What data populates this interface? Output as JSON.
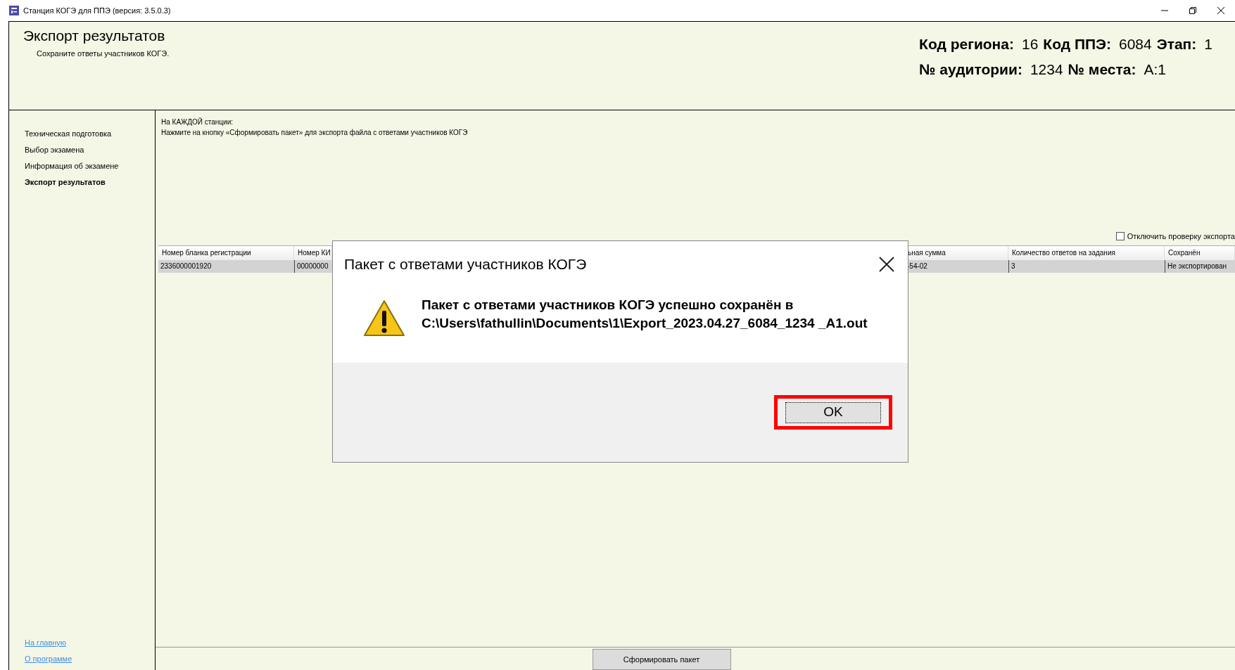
{
  "window": {
    "title": "Станция КОГЭ для ППЭ (версия: 3.5.0.3)"
  },
  "header": {
    "title": "Экспорт результатов",
    "subtitle": "Сохраните ответы участников КОГЭ.",
    "info_lines": [
      [
        {
          "label": "Код региона:",
          "value": "16"
        },
        {
          "label": "Код ППЭ:",
          "value": "6084"
        },
        {
          "label": "Этап:",
          "value": "1"
        }
      ],
      [
        {
          "label": "№ аудитории:",
          "value": "1234"
        },
        {
          "label": "№ места:",
          "value": "А:1"
        }
      ]
    ]
  },
  "sidebar": {
    "items": [
      {
        "label": "Техническая подготовка",
        "selected": false
      },
      {
        "label": "Выбор экзамена",
        "selected": false
      },
      {
        "label": "Информация об экзамене",
        "selected": false
      },
      {
        "label": "Экспорт результатов",
        "selected": true
      }
    ],
    "links": [
      "На главную",
      "О программе"
    ]
  },
  "instructions": [
    "На КАЖДОЙ станции:",
    "Нажмите на кнопку «Сформировать пакет» для экспорта файла с ответами участников КОГЭ"
  ],
  "disable_check": {
    "label": "Отключить проверку экспорта",
    "checked": false
  },
  "table": {
    "columns": [
      "Номер бланка регистрации",
      "Номер КИ",
      "ьная сумма",
      "Количество ответов на задания",
      "Сохранён"
    ],
    "rows": [
      {
        "selected": true,
        "cells": [
          "2336000001920",
          "00000000",
          "-54-02",
          "3",
          "Не экспортирован"
        ]
      }
    ]
  },
  "form_button": "Сформировать пакет",
  "dialog": {
    "title": "Пакет с ответами участников КОГЭ",
    "message": "Пакет с ответами участников КОГЭ успешно сохранён в C:\\Users\\fathullin\\Documents\\1\\Export_2023.04.27_6084_1234 _A1.out",
    "ok": {
      "label": "OK",
      "highlighted": true
    }
  }
}
